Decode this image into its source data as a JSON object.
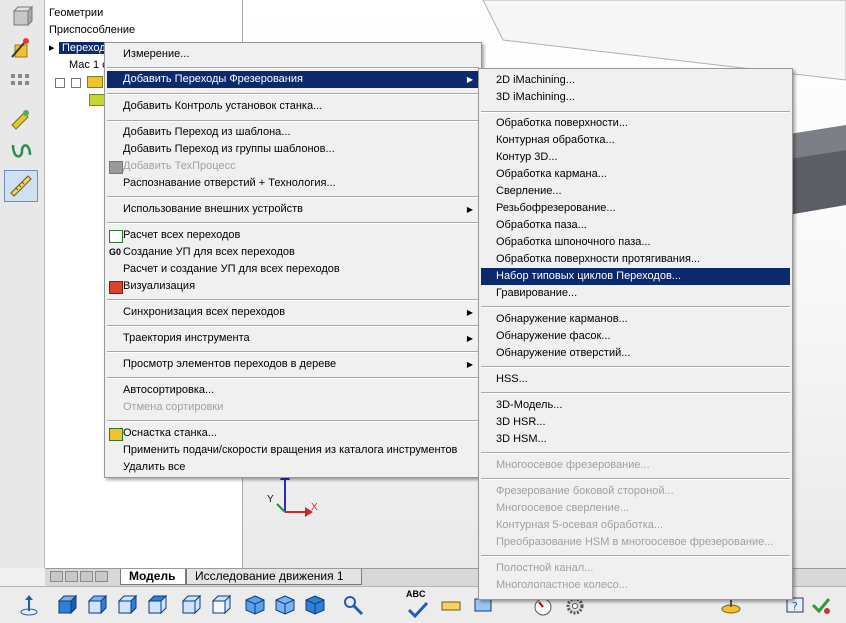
{
  "tree": {
    "row1": "Геометрии",
    "row2": "Приспособление",
    "row3": "Переходы",
    "row4": "Мас 1 с"
  },
  "tabs": {
    "model": "Модель",
    "motion": "Исследование движения 1"
  },
  "triad": {
    "x": "X",
    "y": "Y"
  },
  "bottom_toolbar": {
    "abc_label": "ABC"
  },
  "context_menu": {
    "measure": "Измерение...",
    "add_milling": "Добавить Переходы Фрезерования",
    "add_setup_check": "Добавить Контроль установок станка...",
    "add_from_template": "Добавить Переход из шаблона...",
    "add_from_template_group": "Добавить Переход из группы шаблонов...",
    "add_techprocess": "Добавить ТехПроцесс",
    "hole_recognition": "Распознавание отверстий + Технология...",
    "external_devices": "Использование внешних устройств",
    "calc_all": "Расчет всех переходов",
    "create_nc_all": "Создание УП для всех переходов",
    "calc_create_nc_all": "Расчет и создание УП для всех переходов",
    "visualization": "Визуализация",
    "sync_all": "Синхронизация всех переходов",
    "toolpath": "Траектория инструмента",
    "view_elements": "Просмотр элементов переходов в дереве",
    "autosort": "Автосортировка...",
    "cancel_sort": "Отмена сортировки",
    "machine_tooling": "Оснастка станка...",
    "apply_feeds": "Применить подачи/скорости вращения из каталога инструментов",
    "delete_all": "Удалить все"
  },
  "submenu": {
    "imachining_2d": "2D iMachining...",
    "imachining_3d": "3D iMachining...",
    "face_milling": "Обработка поверхности...",
    "profile": "Контурная обработка...",
    "contour_3d": "Контур 3D...",
    "pocket": "Обработка кармана...",
    "drilling": "Сверление...",
    "thread_milling": "Резьбофрезерование...",
    "slot": "Обработка паза...",
    "keyway": "Обработка шпоночного паза...",
    "broaching": "Обработка поверхности протягивания...",
    "cycle_set": "Набор типовых циклов Переходов...",
    "engraving": "Гравирование...",
    "pocket_recog": "Обнаружение карманов...",
    "chamfer_recog": "Обнаружение фасок...",
    "hole_recog": "Обнаружение отверстий...",
    "hss": "HSS...",
    "model_3d": "3D-Модель...",
    "hsr_3d": "3D HSR...",
    "hsm_3d": "3D HSM...",
    "multiaxis": "Многоосевое фрезерование...",
    "side_milling": "Фрезерование боковой стороной...",
    "multiaxis_drill": "Многоосевое сверление...",
    "contour_5axis": "Контурная 5-осевая обработка...",
    "hsm_to_multiaxis": "Преобразование HSM в многоосевое фрезерование...",
    "channel": "Полостной канал...",
    "impeller": "Многолопастное колесо..."
  },
  "colors": {
    "highlight": "#0b2a6e",
    "menu_bg": "#f0f0f0",
    "disabled": "#a0a0a0"
  }
}
